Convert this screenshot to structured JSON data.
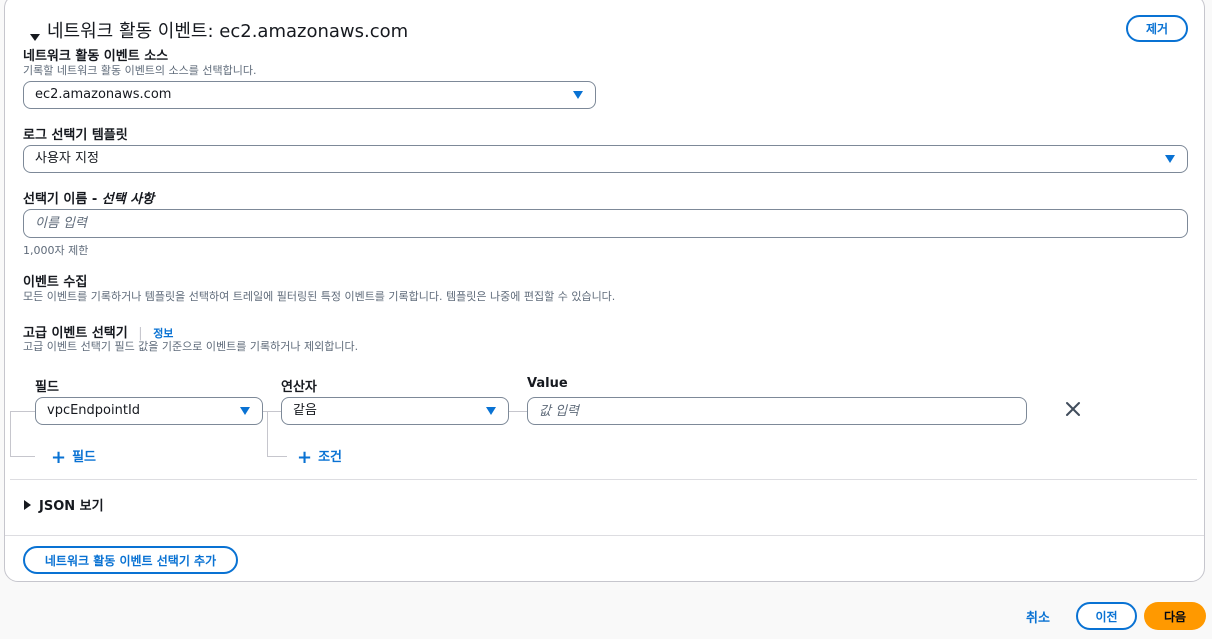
{
  "section": {
    "title": "네트워크 활동 이벤트: ec2.amazonaws.com",
    "remove_label": "제거"
  },
  "source": {
    "label": "네트워크 활동 이벤트 소스",
    "description": "기록할 네트워크 활동 이벤트의 소스를 선택합니다.",
    "value": "ec2.amazonaws.com"
  },
  "template": {
    "label": "로그 선택기 템플릿",
    "value": "사용자 지정"
  },
  "selector_name": {
    "label": "선택기 이름 - ",
    "label_optional": "선택 사항",
    "placeholder": "이름 입력",
    "hint": "1,000자 제한"
  },
  "event_collection": {
    "label": "이벤트 수집",
    "description": "모든 이벤트를 기록하거나 템플릿을 선택하여 트레일에 필터링된 특정 이벤트를 기록합니다. 템플릿은 나중에 편집할 수 있습니다."
  },
  "advanced": {
    "label": "고급 이벤트 선택기",
    "info_link": "정보",
    "description": "고급 이벤트 선택기 필드 값을 기준으로 이벤트를 기록하거나 제외합니다."
  },
  "condition": {
    "field_header": "필드",
    "operator_header": "연산자",
    "value_header": "Value",
    "field_value": "vpcEndpointId",
    "operator_value": "같음",
    "value_placeholder": "값 입력",
    "add_field": "필드",
    "add_condition": "조건"
  },
  "json_view": {
    "label": "JSON 보기"
  },
  "add_selector_label": "네트워크 활동 이벤트 선택기 추가",
  "footer": {
    "cancel": "취소",
    "previous": "이전",
    "next": "다음"
  },
  "colors": {
    "accent": "#0972d3",
    "primary_button": "#ff9900",
    "text": "#16191f",
    "muted": "#5f6b7a"
  }
}
